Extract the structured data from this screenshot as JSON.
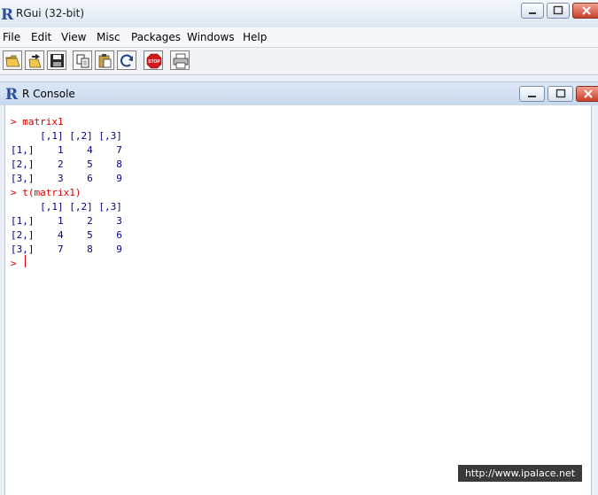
{
  "window": {
    "title": "RGui (32-bit)"
  },
  "menu": [
    "File",
    "Edit",
    "View",
    "Misc",
    "Packages",
    "Windows",
    "Help"
  ],
  "toolbar": {
    "buttons": [
      {
        "name": "open-script-button",
        "icon": "open-folder-icon"
      },
      {
        "name": "load-workspace-button",
        "icon": "load-workspace-icon"
      },
      {
        "name": "save-workspace-button",
        "icon": "floppy-disk-icon"
      },
      {
        "name": "copy-button",
        "icon": "copy-icon"
      },
      {
        "name": "paste-button",
        "icon": "paste-icon"
      },
      {
        "name": "copy-paste-button",
        "icon": "refresh-icon"
      },
      {
        "name": "stop-button",
        "icon": "stop-sign-icon",
        "label": "STOP"
      },
      {
        "name": "print-button",
        "icon": "printer-icon"
      }
    ]
  },
  "console": {
    "title": "R Console",
    "lines": [
      {
        "kind": "cmd",
        "text": "> matrix1"
      },
      {
        "kind": "out",
        "text": "     [,1] [,2] [,3]"
      },
      {
        "kind": "out",
        "text": "[1,]    1    4    7"
      },
      {
        "kind": "out",
        "text": "[2,]    2    5    8"
      },
      {
        "kind": "out",
        "text": "[3,]    3    6    9"
      },
      {
        "kind": "cmd",
        "text": "> t(matrix1)"
      },
      {
        "kind": "out",
        "text": "     [,1] [,2] [,3]"
      },
      {
        "kind": "out",
        "text": "[1,]    1    2    3"
      },
      {
        "kind": "out",
        "text": "[2,]    4    5    6"
      },
      {
        "kind": "out",
        "text": "[3,]    7    8    9"
      },
      {
        "kind": "cmd",
        "text": "> "
      }
    ]
  },
  "watermark": "http://www.ipalace.net",
  "colors": {
    "command": "#d40000",
    "output": "#000080",
    "close_button": "#c8402a"
  }
}
